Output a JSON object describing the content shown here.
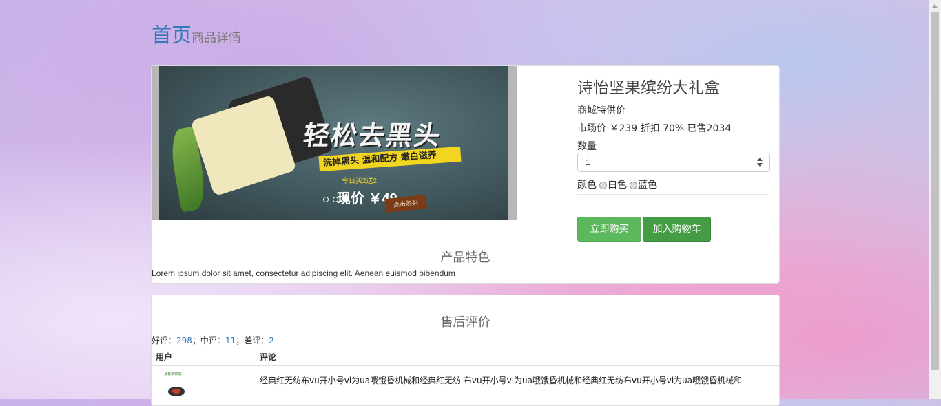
{
  "header": {
    "home_link": "首页",
    "subtitle": "商品详情"
  },
  "carousel": {
    "banner_headline": "轻松去黑头",
    "banner_tagline": "洗掉黑头 温和配方 嫩白滋养",
    "banner_promo": "今日买2送2",
    "banner_price": "现价 ￥49",
    "banner_buy_label": "点击购买",
    "slide_count": 3,
    "active_slide": 3
  },
  "product": {
    "name": "诗怡坚果缤纷大礼盒",
    "special_price_label": "商城特供价",
    "market_price_line": "市场价 ￥239  折扣 70%  已售2034",
    "quantity_label": "数量",
    "quantity_value": "1",
    "color_label": "颜色",
    "color_options": [
      "白色",
      "蓝色"
    ],
    "buy_now_label": "立即购买",
    "add_to_cart_label": "加入购物车"
  },
  "features": {
    "title": "产品特色",
    "description": "Lorem ipsum dolor sit amet, consectetur adipiscing elit. Aenean euismod bibendum"
  },
  "reviews": {
    "title": "售后评价",
    "good_label": "好评：",
    "good_count": "298",
    "mid_label": "；中评：",
    "mid_count": "11",
    "bad_label": "；差评：",
    "bad_count": "2",
    "columns": [
      "用户",
      "评论"
    ],
    "rows": [
      {
        "thumb_text": "成都牌铁锅",
        "comment": "经典红无纺布vu开小号vi为ua哦饿昏机械和经典红无纺 布vu开小号vi为ua哦饿昏机械和经典红无纺布vu开小号vi为ua哦饿昏机械和"
      }
    ]
  }
}
